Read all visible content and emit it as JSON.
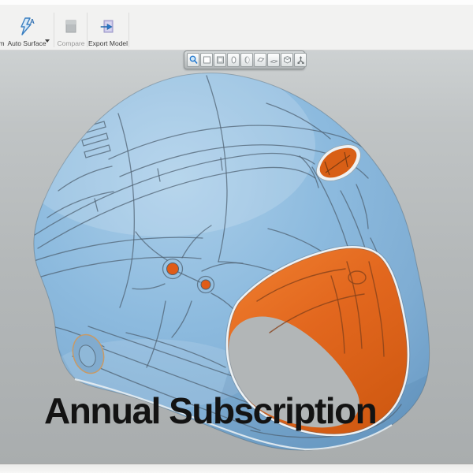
{
  "ribbon": {
    "partial_button_label": "m",
    "buttons": [
      {
        "label": "Auto Surface",
        "icon": "auto-surface-lightning-icon",
        "enabled": true,
        "has_dropdown": true
      },
      {
        "label": "Compare",
        "icon": "compare-icon",
        "enabled": false
      },
      {
        "label": "Export Model",
        "icon": "export-model-icon",
        "enabled": true
      }
    ]
  },
  "view_toolbar": {
    "buttons": [
      {
        "icon": "zoom-icon"
      },
      {
        "icon": "front-view-icon"
      },
      {
        "icon": "back-view-icon"
      },
      {
        "icon": "left-view-icon"
      },
      {
        "icon": "right-view-icon"
      },
      {
        "icon": "top-view-icon"
      },
      {
        "icon": "bottom-view-icon"
      },
      {
        "icon": "isometric-view-icon"
      },
      {
        "icon": "multi-view-icon"
      }
    ]
  },
  "viewport": {
    "overlay_text": "Annual Subscription",
    "model": "motorcycle-helmet-3d-scan",
    "model_colors": {
      "surface": "#8ab7db",
      "interior": "#e2671e",
      "wireframe": "#4e6070",
      "background": "#b2b6b7"
    }
  }
}
